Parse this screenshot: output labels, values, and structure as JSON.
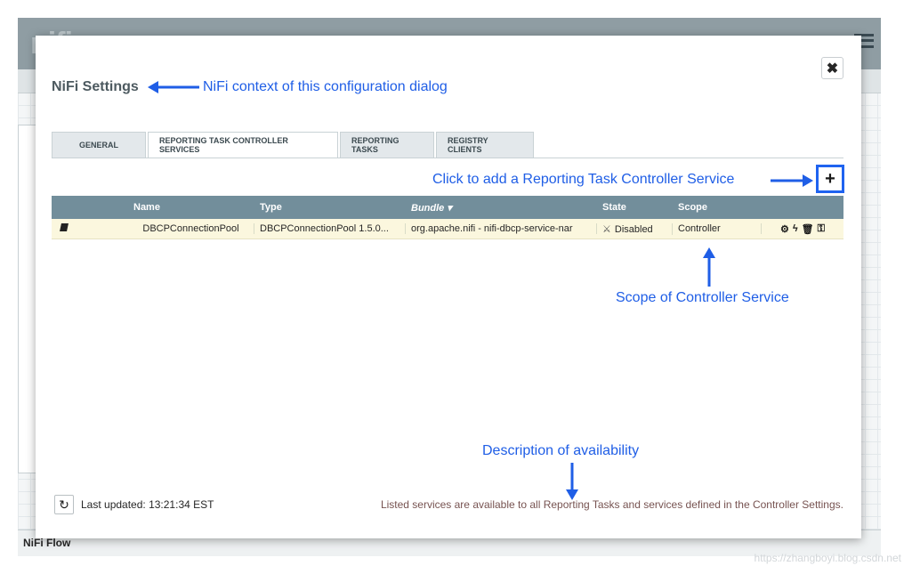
{
  "background": {
    "logo_text": "nifi",
    "footer_label": "NiFi Flow",
    "watermark": "https://zhangboyi.blog.csdn.net"
  },
  "dialog": {
    "title": "NiFi Settings",
    "close_icon": "close-icon",
    "tabs": [
      {
        "label": "GENERAL",
        "active": false
      },
      {
        "label": "REPORTING TASK CONTROLLER SERVICES",
        "active": true
      },
      {
        "label": "REPORTING TASKS",
        "active": false
      },
      {
        "label": "REGISTRY CLIENTS",
        "active": false
      }
    ],
    "add_button_label": "+",
    "table": {
      "columns": [
        "",
        "Name",
        "Type",
        "Bundle",
        "State",
        "Scope",
        ""
      ],
      "sort_column": "Bundle",
      "rows": [
        {
          "name": "DBCPConnectionPool",
          "type": "DBCPConnectionPool 1.5.0...",
          "bundle": "org.apache.nifi - nifi-dbcp-service-nar",
          "state": "Disabled",
          "scope": "Controller",
          "actions": [
            "gear-icon",
            "lightning-icon",
            "trash-icon",
            "key-icon"
          ]
        }
      ]
    },
    "footer": {
      "last_updated_label": "Last updated:",
      "last_updated_value": "13:21:34 EST",
      "note": "Listed services are available to all Reporting Tasks and services defined in the Controller Settings."
    }
  },
  "annotations": {
    "title_note": "NiFi context of this configuration dialog",
    "add_note": "Click to add a Reporting Task Controller Service",
    "scope_note": "Scope of Controller Service",
    "availability_note": "Description of availability",
    "color": "#1f5ee6"
  }
}
